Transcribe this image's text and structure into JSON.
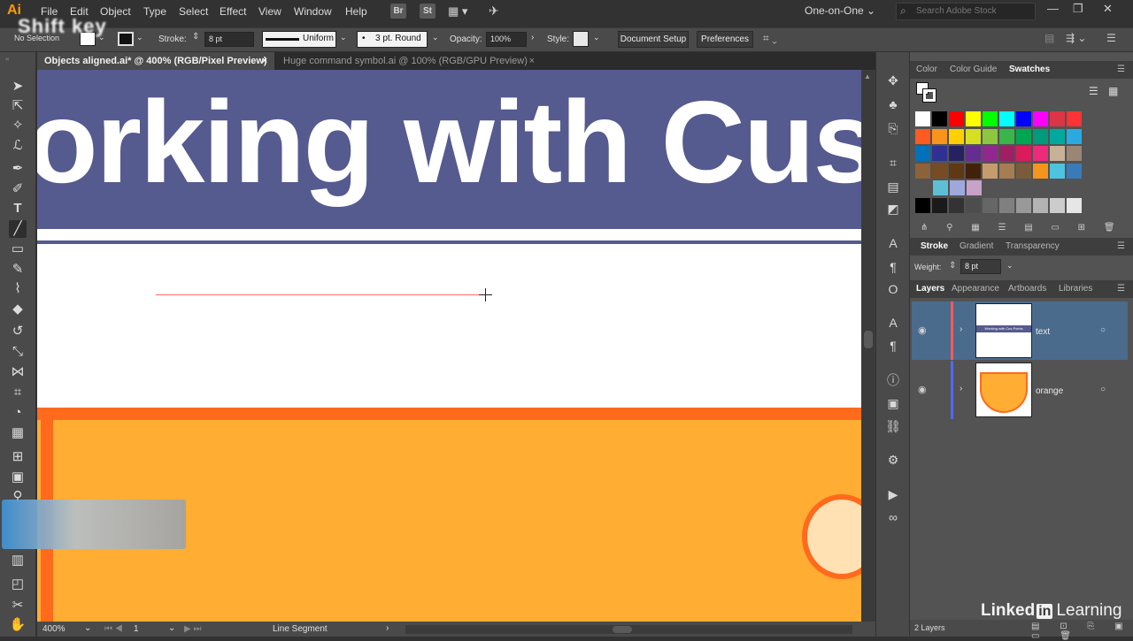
{
  "app": {
    "logo": "Ai",
    "menus": [
      "File",
      "Edit",
      "Object",
      "Type",
      "Select",
      "Effect",
      "View",
      "Window",
      "Help"
    ],
    "bridge_label": "Br",
    "stock_label": "St",
    "workspace": "One-on-One",
    "search_placeholder": "Search Adobe Stock"
  },
  "control_bar": {
    "selection": "No Selection",
    "stroke_label": "Stroke:",
    "stroke_weight": "8 pt",
    "profile": "Uniform",
    "brush": "3 pt. Round",
    "opacity_label": "Opacity:",
    "opacity": "100%",
    "style_label": "Style:",
    "document_setup": "Document Setup",
    "preferences": "Preferences"
  },
  "tabs": [
    {
      "label": "Objects aligned.ai* @ 400% (RGB/Pixel Preview)",
      "close": "×"
    },
    {
      "label": "Huge command symbol.ai @ 100% (RGB/GPU Preview)",
      "close": "×"
    }
  ],
  "artwork": {
    "headline": "orking with Cus",
    "key_overlay": "Shift key"
  },
  "status": {
    "zoom": "400%",
    "artboard": "1",
    "tool": "Line Segment"
  },
  "color_panel": {
    "tabs": [
      "Color",
      "Color Guide",
      "Swatches"
    ]
  },
  "stroke_panel": {
    "tabs": [
      "Stroke",
      "Gradient",
      "Transparency"
    ],
    "weight_label": "Weight:",
    "weight": "8 pt"
  },
  "layers_panel": {
    "tabs": [
      "Layers",
      "Appearance",
      "Artboards",
      "Libraries"
    ],
    "layers": [
      {
        "name": "text",
        "thumb_text": "Working with Cus Points"
      },
      {
        "name": "orange"
      }
    ],
    "count": "2 Layers"
  },
  "watermark": {
    "brand": "Linked",
    "in": "in",
    "suffix": "Learning"
  },
  "colors": {
    "title_band": "#555a8f",
    "orange": "#ffad33",
    "orange_stroke": "#ff6a1c",
    "drawn_line": "#ff6b6b",
    "selected_layer": "#4a6b8c"
  },
  "swatches": {
    "row1": [
      "#ffffff",
      "#000000",
      "#ff0000",
      "#ffff00",
      "#00ff00",
      "#00ffff",
      "#0000ff",
      "#ff00ff",
      "#dc3545",
      "#ff3333"
    ],
    "row2": [
      "#ff5a1f",
      "#f7941d",
      "#ffcf00",
      "#d7df23",
      "#8dc63f",
      "#39b54a",
      "#00a651",
      "#009a7c",
      "#00a99d",
      "#29abe2"
    ],
    "row3": [
      "#0072bc",
      "#2e3192",
      "#262262",
      "#662d91",
      "#92278f",
      "#9e1f63",
      "#da1c5c",
      "#ee2a7b",
      "#c7b299",
      "#998675"
    ],
    "row4": [
      "#8c6239",
      "#754c24",
      "#603813",
      "#42210b",
      "#c69c6d",
      "#a67c52",
      "#7a5c3a",
      "#f7941d",
      "#4ec3e0",
      "#3a7ab8"
    ],
    "row5": [
      "#5dbfd6",
      "#9fa8da",
      "#c8a2c8"
    ],
    "row6": [
      "#000000",
      "#1a1a1a",
      "#333333",
      "#4d4d4d",
      "#666666",
      "#808080",
      "#999999",
      "#b3b3b3",
      "#cccccc",
      "#e6e6e6"
    ]
  }
}
